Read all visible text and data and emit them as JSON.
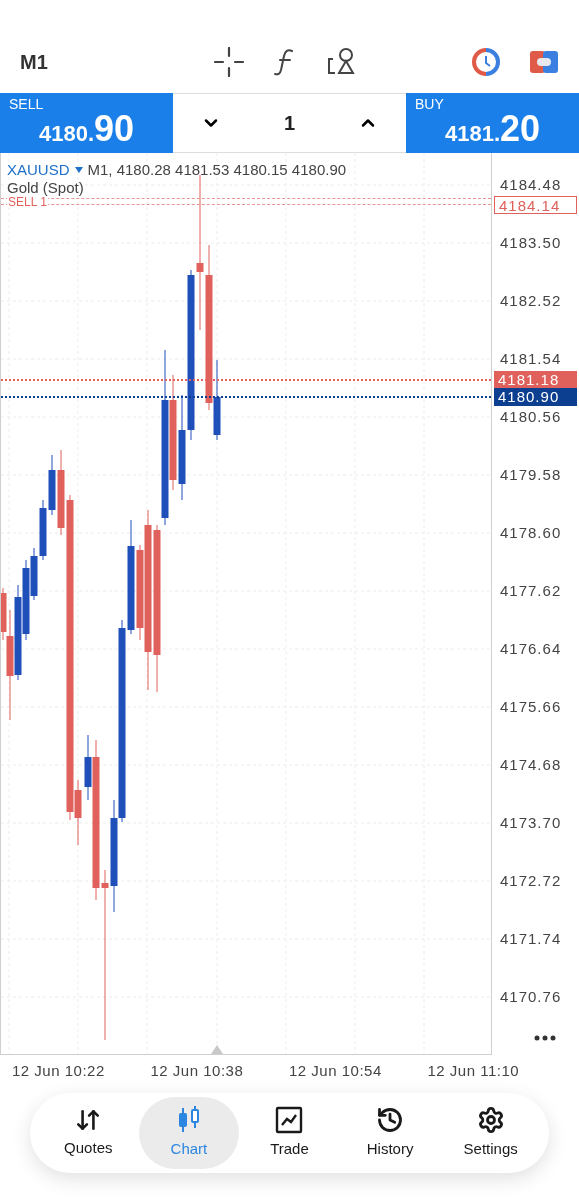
{
  "toolbar": {
    "timeframe": "M1"
  },
  "trade_panel": {
    "sell": {
      "label": "SELL",
      "price_small": "4180.",
      "price_big": "90"
    },
    "volume": "1",
    "buy": {
      "label": "BUY",
      "price_small": "4181.",
      "price_big": "20"
    }
  },
  "chart": {
    "symbol": "XAUUSD",
    "header": "M1, 4180.28 4181.53 4180.15 4180.90",
    "description": "Gold (Spot)",
    "order_label": "SELL 1",
    "price_axis": [
      "4184.48",
      "4183.50",
      "4182.52",
      "4181.54",
      "4180.56",
      "4179.58",
      "4178.60",
      "4177.62",
      "4176.64",
      "4175.66",
      "4174.68",
      "4173.70",
      "4172.72",
      "4171.74",
      "4170.76"
    ],
    "price_tags": [
      {
        "kind": "order",
        "text": "4184.14"
      },
      {
        "kind": "ask",
        "text": "4181.18"
      },
      {
        "kind": "bid",
        "text": "4180.90"
      }
    ],
    "time_axis": [
      "12 Jun 10:22",
      "12 Jun 10:38",
      "12 Jun 10:54",
      "12 Jun 11:10"
    ]
  },
  "nav": [
    {
      "label": "Quotes",
      "selected": false
    },
    {
      "label": "Chart",
      "selected": true
    },
    {
      "label": "Trade",
      "selected": false
    },
    {
      "label": "History",
      "selected": false
    },
    {
      "label": "Settings",
      "selected": false
    }
  ]
}
